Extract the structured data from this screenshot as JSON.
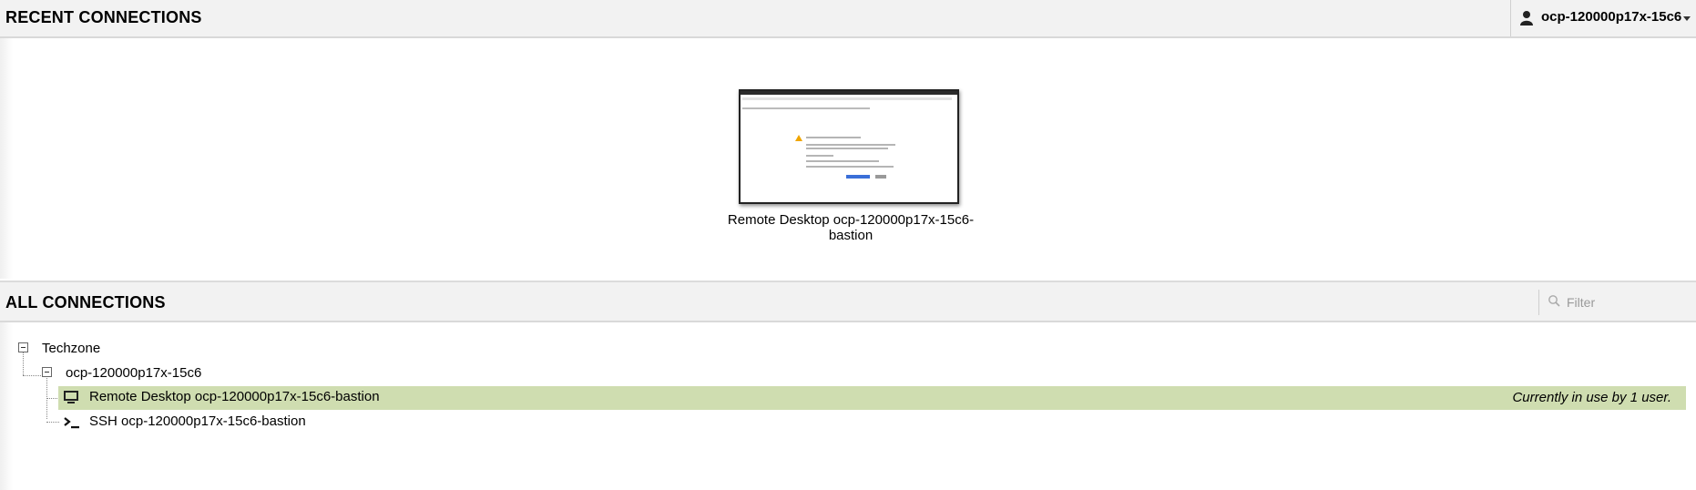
{
  "recent": {
    "header": "RECENT CONNECTIONS",
    "tiles": [
      {
        "name": "Remote Desktop ocp-120000p17x-15c6-bastion"
      }
    ]
  },
  "user_menu": {
    "icon": "user-icon",
    "username": "ocp-120000p17x-15c6"
  },
  "all": {
    "header": "ALL CONNECTIONS",
    "filter_placeholder": "Filter",
    "tree": {
      "group": "Techzone",
      "subgroup": "ocp-120000p17x-15c6",
      "connections": [
        {
          "name": "Remote Desktop ocp-120000p17x-15c6-bastion",
          "icon": "desktop-icon",
          "active": true,
          "usage": "Currently in use by 1 user."
        },
        {
          "name": "SSH ocp-120000p17x-15c6-bastion",
          "icon": "terminal-icon",
          "active": false
        }
      ]
    }
  },
  "colors": {
    "header_bg": "#f2f2f2",
    "active_row": "#cfddb0"
  }
}
